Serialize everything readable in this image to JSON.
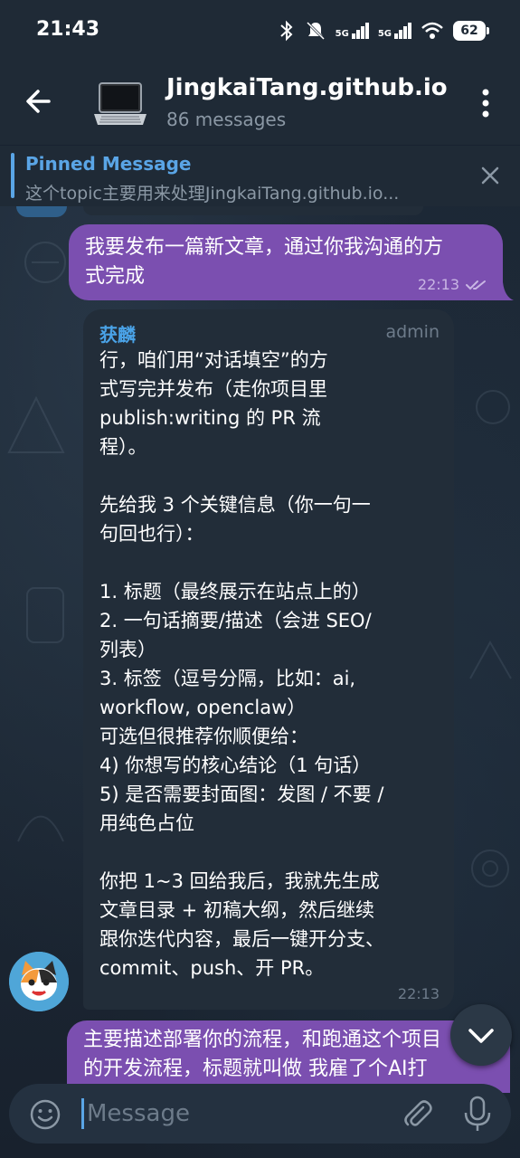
{
  "status": {
    "time": "21:43",
    "battery": "62",
    "signal1": "5G",
    "signal2": "5G"
  },
  "header": {
    "title": "JingkaiTang.github.io",
    "subtitle": "86 messages"
  },
  "pinned": {
    "title": "Pinned Message",
    "text": "这个topic主要用来处理JingkaiTang.github.io..."
  },
  "messages": [
    {
      "text": "我要发布一篇新文章，通过你我沟通的方\n式完成",
      "time": "22:13"
    },
    {
      "sender": "获麟",
      "role": "admin",
      "text": "行，咱们用“对话填空”的方\n式写完并发布（走你项目里\npublish:writing 的 PR 流\n程）。\n\n先给我 3 个关键信息（你一句一\n句回也行）：\n\n1. 标题（最终展示在站点上的）\n2. 一句话摘要/描述（会进 SEO/\n列表）\n3. 标签（逗号分隔，比如：ai,\nworkflow, openclaw）\n可选但很推荐你顺便给：\n4) 你想写的核心结论（1 句话）\n5) 是否需要封面图：发图 / 不要 /\n用纯色占位\n\n你把 1~3 回给我后，我就先生成\n文章目录 + 初稿大纲，然后继续\n跟你迭代内容，最后一键开分支、\ncommit、push、开 PR。",
      "time": "22:13"
    },
    {
      "text": "主要描述部署你的流程，和跑通这个项目\n的开发流程，标题就叫做 我雇了个AI打"
    }
  ],
  "input": {
    "placeholder": "Message"
  },
  "colors": {
    "accent": "#5aa5e6",
    "outgoing": "#7b4fb0",
    "incoming": "#222d39",
    "header": "#1f2a36"
  }
}
